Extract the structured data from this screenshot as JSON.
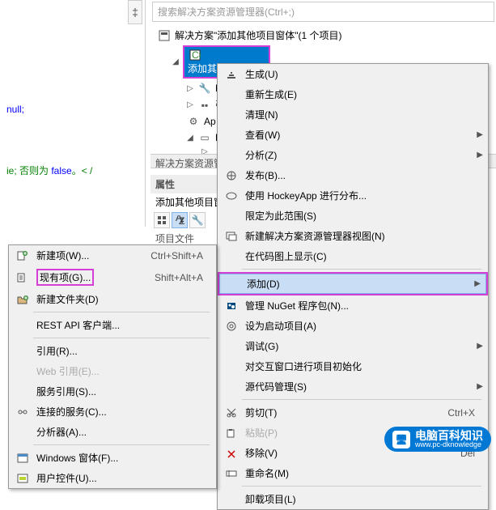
{
  "code": {
    "null_label": "null;",
    "comment_prefix": "ie; 否则为 ",
    "false_label": "false",
    "comment_suffix": "。< /"
  },
  "code_gutter_glyph": "‡",
  "explorer": {
    "search_placeholder": "搜索解决方案资源管理器(Ctrl+;)",
    "solution_label": "解决方案\"添加其他项目窗体\"(1 个项目)",
    "project_label": "添加其他项目窗体",
    "nodes": {
      "pr": "Pr",
      "yin": "引",
      "ap": "Ap",
      "fo": "Fo"
    }
  },
  "sep_bar_label": "解决方案资源管",
  "properties": {
    "title": "属性",
    "subtitle": "添加其他项目窗",
    "row_label": "项目文件"
  },
  "menu_left": [
    {
      "icon": "new-item-icon",
      "label": "新建项(W)...",
      "shortcut": "Ctrl+Shift+A",
      "interactable": true
    },
    {
      "icon": "existing-item-icon",
      "label": "现有项(G)...",
      "shortcut": "Shift+Alt+A",
      "interactable": true,
      "highlight": true
    },
    {
      "icon": "new-folder-icon",
      "label": "新建文件夹(D)",
      "interactable": true
    },
    {
      "sep": true
    },
    {
      "label": "REST API 客户端...",
      "interactable": true
    },
    {
      "sep": true
    },
    {
      "label": "引用(R)...",
      "interactable": true
    },
    {
      "label": "Web 引用(E)...",
      "interactable": false
    },
    {
      "label": "服务引用(S)...",
      "interactable": true
    },
    {
      "icon": "connected-service-icon",
      "label": "连接的服务(C)...",
      "interactable": true
    },
    {
      "label": "分析器(A)...",
      "interactable": true
    },
    {
      "sep": true
    },
    {
      "icon": "window-icon",
      "label": "Windows 窗体(F)...",
      "interactable": true
    },
    {
      "icon": "user-control-icon",
      "label": "用户控件(U)...",
      "interactable": true
    }
  ],
  "menu_right": [
    {
      "icon": "build-icon",
      "label": "生成(U)",
      "interactable": true
    },
    {
      "label": "重新生成(E)",
      "interactable": true
    },
    {
      "label": "清理(N)",
      "interactable": true
    },
    {
      "label": "查看(W)",
      "submenu": true,
      "interactable": true
    },
    {
      "label": "分析(Z)",
      "submenu": true,
      "interactable": true
    },
    {
      "icon": "publish-icon",
      "label": "发布(B)...",
      "interactable": true
    },
    {
      "icon": "hockeyapp-icon",
      "label": "使用 HockeyApp 进行分布...",
      "interactable": true
    },
    {
      "label": "限定为此范围(S)",
      "interactable": true
    },
    {
      "icon": "new-explorer-icon",
      "label": "新建解决方案资源管理器视图(N)",
      "interactable": true
    },
    {
      "label": "在代码图上显示(C)",
      "interactable": true
    },
    {
      "sep": true
    },
    {
      "label": "添加(D)",
      "submenu": true,
      "interactable": true,
      "highlighted": true,
      "highlight_outline": true
    },
    {
      "icon": "nuget-icon",
      "label": "管理 NuGet 程序包(N)...",
      "interactable": true
    },
    {
      "icon": "startup-icon",
      "label": "设为启动项目(A)",
      "interactable": true
    },
    {
      "label": "调试(G)",
      "submenu": true,
      "interactable": true
    },
    {
      "label": "对交互窗口进行项目初始化",
      "interactable": true
    },
    {
      "label": "源代码管理(S)",
      "submenu": true,
      "interactable": true
    },
    {
      "sep": true
    },
    {
      "icon": "cut-icon",
      "label": "剪切(T)",
      "shortcut": "Ctrl+X",
      "interactable": true
    },
    {
      "icon": "paste-icon",
      "label": "粘贴(P)",
      "shortcut": "Ctrl+V",
      "interactable": false
    },
    {
      "icon": "remove-icon",
      "label": "移除(V)",
      "shortcut": "Del",
      "interactable": true
    },
    {
      "icon": "rename-icon",
      "label": "重命名(M)",
      "interactable": true
    },
    {
      "sep": true
    },
    {
      "label": "卸载项目(L)",
      "interactable": true
    }
  ],
  "watermark": {
    "cn": "电脑百科知识",
    "en": "www.pc-dknowledge"
  }
}
